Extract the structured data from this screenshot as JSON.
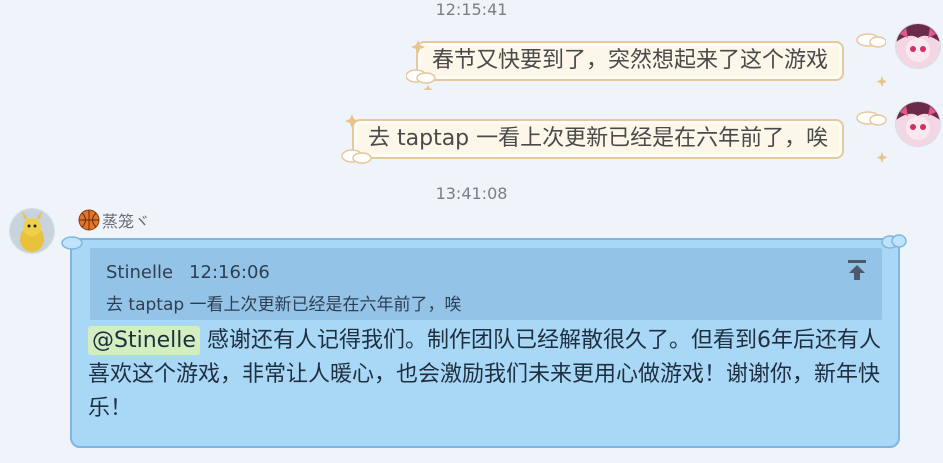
{
  "messages": [
    {
      "timestamp": "12:15:41",
      "text": "春节又快要到了，突然想起来了这个游戏"
    },
    {
      "timestamp": "",
      "text": "去 taptap 一看上次更新已经是在六年前了，唉"
    }
  ],
  "reply_timestamp": "13:41:08",
  "reply": {
    "sender_name": "蒸笼ヾ",
    "quote": {
      "author": "Stinelle",
      "time": "12:16:06",
      "text": "去 taptap 一看上次更新已经是在六年前了，唉"
    },
    "mention": "@Stinelle",
    "text": "感谢还有人记得我们。制作团队已经解散很久了。但看到6年后还有人喜欢这个游戏，非常让人暖心，也会激励我们未来更用心做游戏！谢谢你，新年快乐！"
  },
  "colors": {
    "cream_bubble": "#fdf7ea",
    "cream_border": "#e6c99a",
    "blue_bubble": "#a9d8f7",
    "quote_block": "#93c3e6",
    "mention_highlight": "#d3efc0"
  },
  "icons": {
    "quote_action": "pin-to-top-icon",
    "sender_badge": "basketball-icon"
  }
}
